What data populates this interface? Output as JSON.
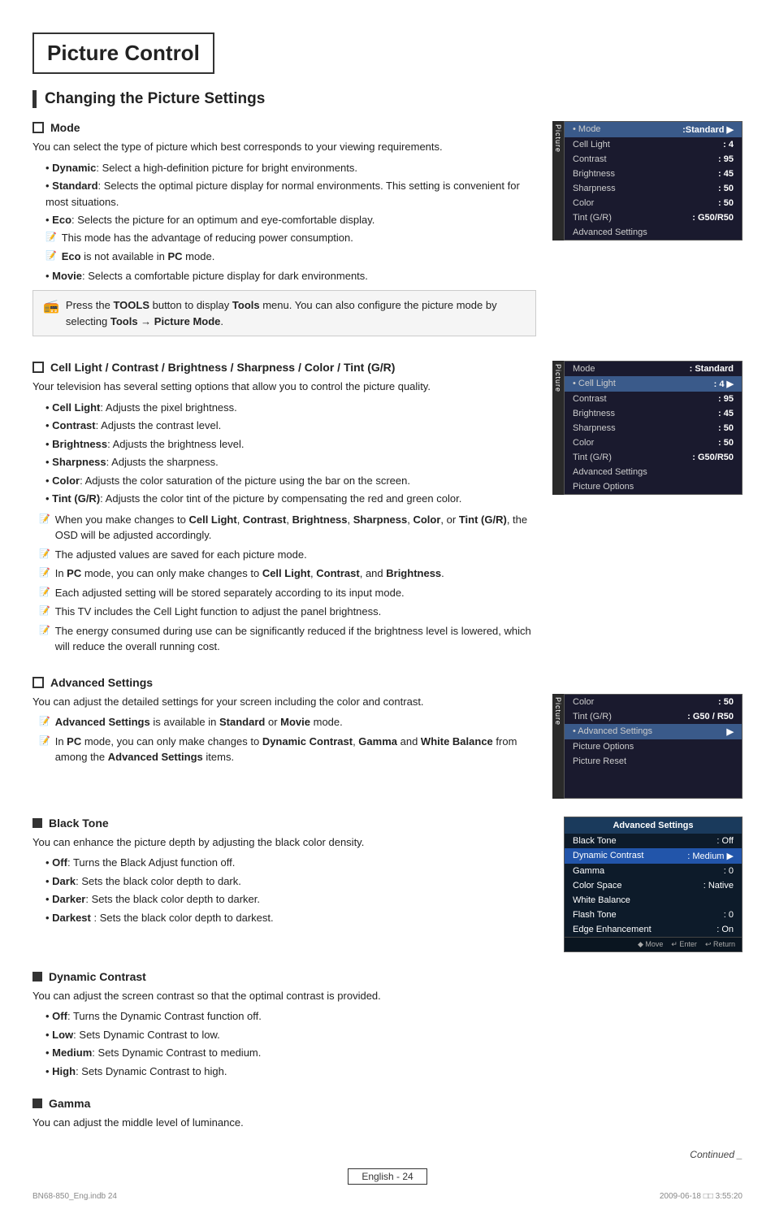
{
  "page": {
    "title": "Picture Control",
    "section1": "Changing the Picture Settings",
    "mode_heading": "Mode",
    "mode_desc": "You can select the type of picture which best corresponds to your viewing requirements.",
    "mode_bullets": [
      {
        "term": "Dynamic",
        "desc": "Select a high-definition picture for bright environments."
      },
      {
        "term": "Standard",
        "desc": "Selects the optimal picture display for normal environments. This setting is convenient for most situations."
      },
      {
        "term": "Eco",
        "desc": "Selects the picture for an optimum and eye-comfortable display."
      },
      {
        "term": "Movie",
        "desc": "Selects a comfortable picture display for dark environments."
      }
    ],
    "eco_note1": "This mode has the advantage of reducing power consumption.",
    "eco_note2": "Eco is not available in PC mode.",
    "tools_note": "Press the TOOLS button to display Tools menu. You can also configure the picture mode by selecting Tools → Picture Mode.",
    "cell_heading": "Cell Light / Contrast / Brightness / Sharpness / Color / Tint (G/R)",
    "cell_desc": "Your television has several setting options that allow you to control the picture quality.",
    "cell_bullets": [
      {
        "term": "Cell Light",
        "desc": "Adjusts the pixel brightness."
      },
      {
        "term": "Contrast",
        "desc": "Adjusts the contrast level."
      },
      {
        "term": "Brightness",
        "desc": "Adjusts the brightness level."
      },
      {
        "term": "Sharpness",
        "desc": "Adjusts the sharpness."
      },
      {
        "term": "Color",
        "desc": "Adjusts the color saturation of the picture using the bar on the screen."
      },
      {
        "term": "Tint (G/R)",
        "desc": "Adjusts the color tint of the picture by compensating the red and green color."
      }
    ],
    "cell_notes": [
      "When you make changes to Cell Light, Contrast, Brightness, Sharpness, Color, or Tint (G/R), the OSD will be adjusted accordingly.",
      "The adjusted values are saved for each picture mode.",
      "In PC mode, you can only make changes to Cell Light, Contrast, and Brightness.",
      "Each adjusted setting will be stored separately according to its input mode.",
      "This TV includes the Cell Light function to adjust the panel brightness.",
      "The energy consumed during use can be significantly reduced if the brightness level is lowered, which will reduce the overall running cost."
    ],
    "adv_heading": "Advanced Settings",
    "adv_desc": "You can adjust the detailed settings for your screen including the color and contrast.",
    "adv_notes": [
      "Advanced Settings is available in Standard or Movie mode.",
      "In PC mode, you can only make changes to Dynamic Contrast, Gamma and White Balance from among the Advanced Settings items."
    ],
    "black_tone_heading": "Black Tone",
    "black_tone_desc": "You can enhance the picture depth by adjusting the black color density.",
    "black_tone_bullets": [
      {
        "term": "Off",
        "desc": "Turns the Black Adjust function off."
      },
      {
        "term": "Dark",
        "desc": "Sets the black color depth to dark."
      },
      {
        "term": "Darker",
        "desc": "Sets the black color depth to darker."
      },
      {
        "term": "Darkest",
        "desc": "Sets the black color depth to darkest."
      }
    ],
    "dynamic_contrast_heading": "Dynamic Contrast",
    "dynamic_contrast_desc": "You can adjust the screen contrast so that the optimal contrast is provided.",
    "dynamic_contrast_bullets": [
      {
        "term": "Off",
        "desc": "Turns the Dynamic Contrast function off."
      },
      {
        "term": "Low",
        "desc": "Sets Dynamic Contrast to low."
      },
      {
        "term": "Medium",
        "desc": "Sets Dynamic Contrast to medium."
      },
      {
        "term": "High",
        "desc": "Sets Dynamic Contrast to high."
      }
    ],
    "gamma_heading": "Gamma",
    "gamma_desc": "You can adjust the middle level of luminance.",
    "continued": "Continued _",
    "footer_label": "English - 24",
    "bottom_left": "BN68-850_Eng.indb  24",
    "bottom_right": "2009-06-18  □□  3:55:20",
    "tv1": {
      "label": "Picture",
      "rows": [
        {
          "label": "• Mode",
          "value": ":Standard",
          "highlighted": true
        },
        {
          "label": "Cell Light",
          "value": ": 4"
        },
        {
          "label": "Contrast",
          "value": ": 95"
        },
        {
          "label": "Brightness",
          "value": ": 45"
        },
        {
          "label": "Sharpness",
          "value": ": 50"
        },
        {
          "label": "Color",
          "value": ": 50"
        },
        {
          "label": "Tint (G/R)",
          "value": ": G50/R50"
        },
        {
          "label": "Advanced Settings",
          "value": ""
        }
      ]
    },
    "tv2": {
      "label": "Picture",
      "rows": [
        {
          "label": "Mode",
          "value": ": Standard"
        },
        {
          "label": "• Cell Light",
          "value": ": 4",
          "highlighted": true
        },
        {
          "label": "Contrast",
          "value": ": 95"
        },
        {
          "label": "Brightness",
          "value": ": 45"
        },
        {
          "label": "Sharpness",
          "value": ": 50"
        },
        {
          "label": "Color",
          "value": ": 50"
        },
        {
          "label": "Tint (G/R)",
          "value": ": G50/R50"
        },
        {
          "label": "Advanced Settings",
          "value": ""
        },
        {
          "label": "Picture Options",
          "value": ""
        }
      ]
    },
    "tv3": {
      "label": "Picture",
      "rows": [
        {
          "label": "Color",
          "value": ": 50"
        },
        {
          "label": "Tint (G/R)",
          "value": ": G50 / R50"
        },
        {
          "label": "• Advanced Settings",
          "value": "",
          "highlighted": true
        },
        {
          "label": "Picture Options",
          "value": ""
        },
        {
          "label": "Picture Reset",
          "value": ""
        }
      ]
    },
    "adv_screen": {
      "title": "Advanced Settings",
      "rows": [
        {
          "label": "Black Tone",
          "value": ": Off"
        },
        {
          "label": "Dynamic Contrast",
          "value": ": Medium",
          "highlighted": true
        },
        {
          "label": "Gamma",
          "value": ": 0"
        },
        {
          "label": "Color Space",
          "value": ": Native"
        },
        {
          "label": "White Balance",
          "value": ""
        },
        {
          "label": "Flash Tone",
          "value": ": 0"
        },
        {
          "label": "Edge Enhancement",
          "value": ": On"
        }
      ],
      "footer": [
        "◆ Move",
        "↵ Enter",
        "↩ Return"
      ]
    }
  }
}
